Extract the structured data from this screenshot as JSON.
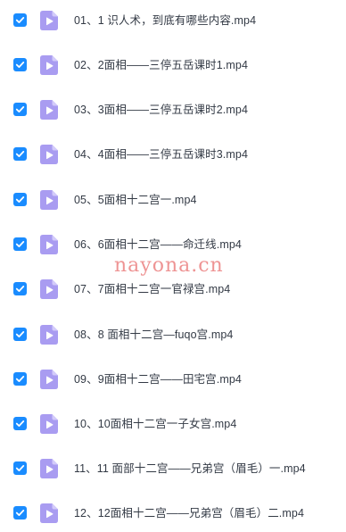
{
  "colors": {
    "checkbox": "#1a8cff",
    "file_icon": "#a99cf1",
    "file_icon_fold": "#d3cbfa",
    "text": "#333a45",
    "watermark": "#e87070"
  },
  "files": [
    {
      "name": "01、1 识人术，到底有哪些内容.mp4",
      "checked": true,
      "icon": "video-file-icon"
    },
    {
      "name": "02、2面相——三停五岳课时1.mp4",
      "checked": true,
      "icon": "video-file-icon"
    },
    {
      "name": "03、3面相——三停五岳课时2.mp4",
      "checked": true,
      "icon": "video-file-icon"
    },
    {
      "name": "04、4面相——三停五岳课时3.mp4",
      "checked": true,
      "icon": "video-file-icon"
    },
    {
      "name": "05、5面相十二宫一.mp4",
      "checked": true,
      "icon": "video-file-icon"
    },
    {
      "name": "06、6面相十二宫——命迁线.mp4",
      "checked": true,
      "icon": "video-file-icon"
    },
    {
      "name": "07、7面相十二宫一官禄宫.mp4",
      "checked": true,
      "icon": "video-file-icon"
    },
    {
      "name": "08、8 面相十二宫—fuqo宫.mp4",
      "checked": true,
      "icon": "video-file-icon"
    },
    {
      "name": "09、9面相十二宫——田宅宫.mp4",
      "checked": true,
      "icon": "video-file-icon"
    },
    {
      "name": "10、10面相十二宫一子女宫.mp4",
      "checked": true,
      "icon": "video-file-icon"
    },
    {
      "name": "11、11 面部十二宫——兄弟宫（眉毛）一.mp4",
      "checked": true,
      "icon": "video-file-icon"
    },
    {
      "name": "12、12面相十二宫——兄弟宫（眉毛）二.mp4",
      "checked": true,
      "icon": "video-file-icon"
    }
  ],
  "watermark": "nayona.cn"
}
